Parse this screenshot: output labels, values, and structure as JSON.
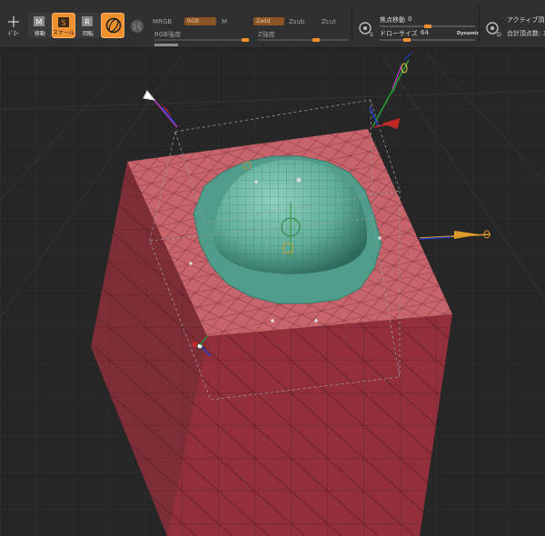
{
  "toolbar": {
    "tools": [
      {
        "name": "draw-tool",
        "label": "ﾄﾞﾛｰ",
        "active": false,
        "icon": "crosshair-icon"
      },
      {
        "name": "move-tool",
        "label": "移動",
        "active": false,
        "icon": "move-icon",
        "key": "M"
      },
      {
        "name": "scale-tool",
        "label": "スケール",
        "active": true,
        "icon": "scale-icon",
        "key": "S"
      },
      {
        "name": "rotate-tool",
        "label": "回転",
        "active": false,
        "icon": "rotate-icon",
        "key": "R"
      },
      {
        "name": "gyro-tool",
        "label": "",
        "active": true,
        "icon": "gyro-icon"
      },
      {
        "name": "polyframe-tool",
        "label": "",
        "active": false,
        "icon": "sphere-icon"
      }
    ],
    "mrgb": "MRGB",
    "rgb": "RGB",
    "m": "M",
    "zadd": "Zadd",
    "zsub": "Zsub",
    "zcut": "Zcut",
    "rgb_intensity": "RGB強度",
    "z_intensity": "Z強度",
    "focal_shift_label": "焦点移動",
    "focal_shift_value": "0",
    "draw_size_label": "ドローサイズ",
    "draw_size_value": "64",
    "dynamic": "Dynamic",
    "active_points": "アクティブ頂",
    "total_points": "合計頂点数: 3"
  },
  "colors": {
    "accent": "#f0912f",
    "mesh_red": "#b24d57",
    "mesh_top": "#c7646c",
    "sphere_green": "#5fae99"
  }
}
